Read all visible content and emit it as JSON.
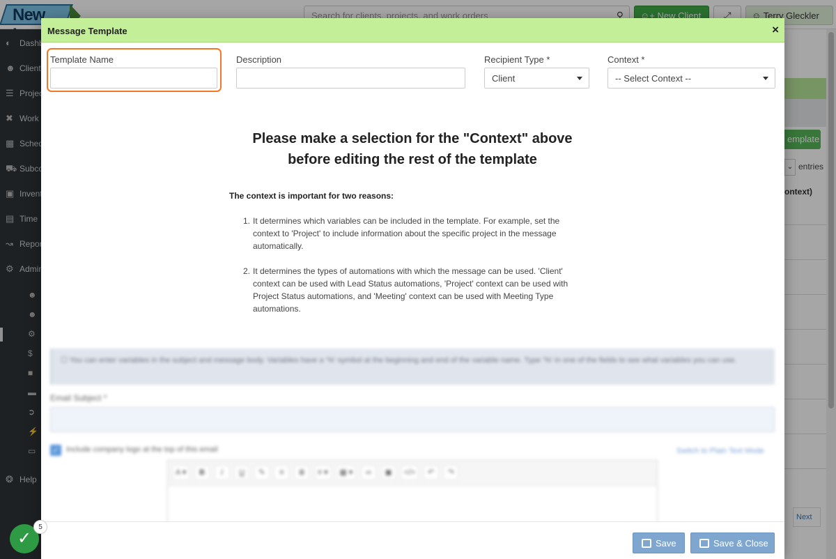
{
  "app": {
    "logo_text": "New Logo",
    "search_placeholder": "Search for clients, projects, and work orders",
    "new_client_label": "New Client",
    "user_name": "Terry Gleckler",
    "sidebar": [
      {
        "label": "Dashboard",
        "icon": "dashboard-icon"
      },
      {
        "label": "Clients",
        "icon": "users-icon"
      },
      {
        "label": "Projects",
        "icon": "list-icon"
      },
      {
        "label": "Work Orders",
        "icon": "wrench-icon"
      },
      {
        "label": "Schedule",
        "icon": "calendar-icon"
      },
      {
        "label": "Subcontractors",
        "icon": "truck-icon"
      },
      {
        "label": "Inventory",
        "icon": "box-icon"
      },
      {
        "label": "Time",
        "icon": "clock-icon"
      },
      {
        "label": "Reports",
        "icon": "chart-icon"
      },
      {
        "label": "Admin",
        "icon": "gears-icon"
      },
      {
        "label": "Help",
        "icon": "lifebuoy-icon"
      }
    ],
    "bg_add_button": "emplate",
    "bg_entries": "entries",
    "bg_column_head": "ontext)",
    "bg_next": "Next",
    "status_count": "5"
  },
  "modal": {
    "title": "Message Template",
    "close_symbol": "×",
    "fields": {
      "template_name_label": "Template Name",
      "template_name_value": "",
      "description_label": "Description",
      "description_value": "",
      "recipient_type_label": "Recipient Type *",
      "recipient_type_value": "Client",
      "context_label": "Context *",
      "context_value": "-- Select Context --"
    },
    "notice": {
      "heading_line1": "Please make a selection for the \"Context\" above",
      "heading_line2": "before editing the rest of the template",
      "reasons_title": "The context is important for two reasons:",
      "reasons": [
        "It determines which variables can be included in the template. For example, set the context to 'Project' to include information about the specific project in the message automatically.",
        "It determines the types of automations with which the message can be used. 'Client' context can be used with Lead Status automations, 'Project' context can be used with Project Status automations, and 'Meeting' context can be used with Meeting Type automations."
      ]
    },
    "disabled_section": {
      "info_text": "You can enter variables in the subject and message body. Variables have a '%' symbol at the beginning and end of the variable name. Type '%' in one of the fields to see what variables you can use.",
      "subject_label": "Email Subject *",
      "include_logo_label": "Include company logo at the top of this email",
      "include_logo_checked": true,
      "plain_text_link": "Switch to Plain Text Mode"
    },
    "footer": {
      "save_label": "Save",
      "save_close_label": "Save & Close"
    }
  }
}
